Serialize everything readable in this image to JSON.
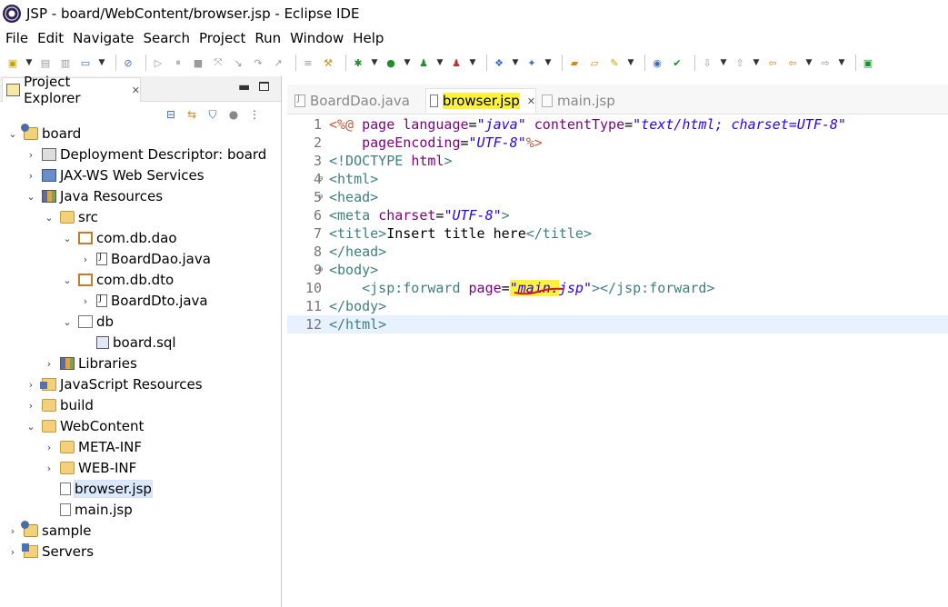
{
  "window": {
    "title": "JSP - board/WebContent/browser.jsp - Eclipse IDE"
  },
  "menu": [
    "File",
    "Edit",
    "Navigate",
    "Search",
    "Project",
    "Run",
    "Window",
    "Help"
  ],
  "explorer": {
    "title": "Project Explorer",
    "tree": [
      {
        "label": "board",
        "level": 0,
        "twisty": "open",
        "icon": "project-icon"
      },
      {
        "label": "Deployment Descriptor: board",
        "level": 1,
        "twisty": "closed",
        "icon": "deployment-descriptor-icon"
      },
      {
        "label": "JAX-WS Web Services",
        "level": 1,
        "twisty": "closed",
        "icon": "web-services-icon"
      },
      {
        "label": "Java Resources",
        "level": 1,
        "twisty": "open",
        "icon": "java-resources-icon"
      },
      {
        "label": "src",
        "level": 2,
        "twisty": "open",
        "icon": "source-folder-icon"
      },
      {
        "label": "com.db.dao",
        "level": 3,
        "twisty": "open",
        "icon": "package-icon"
      },
      {
        "label": "BoardDao.java",
        "level": 4,
        "twisty": "closed",
        "icon": "java-file-icon"
      },
      {
        "label": "com.db.dto",
        "level": 3,
        "twisty": "open",
        "icon": "package-icon"
      },
      {
        "label": "BoardDto.java",
        "level": 4,
        "twisty": "closed",
        "icon": "java-file-icon"
      },
      {
        "label": "db",
        "level": 3,
        "twisty": "open",
        "icon": "empty-package-icon"
      },
      {
        "label": "board.sql",
        "level": 4,
        "twisty": "none",
        "icon": "sql-file-icon"
      },
      {
        "label": "Libraries",
        "level": 2,
        "twisty": "closed",
        "icon": "libraries-icon"
      },
      {
        "label": "JavaScript Resources",
        "level": 1,
        "twisty": "closed",
        "icon": "javascript-resources-icon"
      },
      {
        "label": "build",
        "level": 1,
        "twisty": "closed",
        "icon": "folder-icon"
      },
      {
        "label": "WebContent",
        "level": 1,
        "twisty": "open",
        "icon": "folder-icon"
      },
      {
        "label": "META-INF",
        "level": 2,
        "twisty": "closed",
        "icon": "folder-icon"
      },
      {
        "label": "WEB-INF",
        "level": 2,
        "twisty": "closed",
        "icon": "folder-icon"
      },
      {
        "label": "browser.jsp",
        "level": 2,
        "twisty": "none",
        "icon": "jsp-file-icon",
        "selected": true
      },
      {
        "label": "main.jsp",
        "level": 2,
        "twisty": "none",
        "icon": "jsp-file-icon"
      },
      {
        "label": "sample",
        "level": 0,
        "twisty": "closed",
        "icon": "project-icon"
      },
      {
        "label": "Servers",
        "level": 0,
        "twisty": "closed",
        "icon": "servers-icon"
      }
    ]
  },
  "editor": {
    "tabs": [
      {
        "label": "BoardDao.java",
        "active": false
      },
      {
        "label": "browser.jsp",
        "active": true
      },
      {
        "label": "main.jsp",
        "active": false
      }
    ],
    "lines": [
      {
        "n": "1",
        "fold": "",
        "tokens": [
          [
            "dir",
            "<%@ "
          ],
          [
            "atn",
            "page "
          ],
          [
            "atn",
            "language"
          ],
          [
            "plain",
            "="
          ],
          [
            "atv",
            "\"java\""
          ],
          [
            "plain",
            " "
          ],
          [
            "atn",
            "contentType"
          ],
          [
            "plain",
            "="
          ],
          [
            "atv",
            "\"text/html; charset=UTF-8\""
          ]
        ]
      },
      {
        "n": "2",
        "fold": "",
        "tokens": [
          [
            "plain",
            "    "
          ],
          [
            "atn",
            "pageEncoding"
          ],
          [
            "plain",
            "="
          ],
          [
            "atv",
            "\"UTF-8\""
          ],
          [
            "dir",
            "%>"
          ]
        ]
      },
      {
        "n": "3",
        "fold": "",
        "tokens": [
          [
            "tag",
            "<!DOCTYPE "
          ],
          [
            "atn",
            "html"
          ],
          [
            "tag",
            ">"
          ]
        ]
      },
      {
        "n": "4",
        "fold": "⊖",
        "tokens": [
          [
            "tag",
            "<html>"
          ]
        ]
      },
      {
        "n": "5",
        "fold": "⊖",
        "tokens": [
          [
            "tag",
            "<head>"
          ]
        ]
      },
      {
        "n": "6",
        "fold": "",
        "tokens": [
          [
            "tag",
            "<meta "
          ],
          [
            "atn",
            "charset"
          ],
          [
            "plain",
            "="
          ],
          [
            "atv",
            "\"UTF-8\""
          ],
          [
            "tag",
            ">"
          ]
        ]
      },
      {
        "n": "7",
        "fold": "",
        "tokens": [
          [
            "tag",
            "<title>"
          ],
          [
            "plain",
            "Insert title here"
          ],
          [
            "tag",
            "</title>"
          ]
        ]
      },
      {
        "n": "8",
        "fold": "",
        "tokens": [
          [
            "tag",
            "</head>"
          ]
        ]
      },
      {
        "n": "9",
        "fold": "⊖",
        "tokens": [
          [
            "tag",
            "<body>"
          ]
        ]
      },
      {
        "n": "10",
        "fold": "",
        "tokens": [
          [
            "plain",
            "    "
          ],
          [
            "tag",
            "<jsp:forward "
          ],
          [
            "atn",
            "page"
          ],
          [
            "plain",
            "="
          ],
          [
            "atv-hl",
            "\"main."
          ],
          [
            "atv",
            "jsp\""
          ],
          [
            "tag",
            "></jsp:forward>"
          ]
        ]
      },
      {
        "n": "11",
        "fold": "",
        "tokens": [
          [
            "tag",
            "</body>"
          ]
        ]
      },
      {
        "n": "12",
        "fold": "",
        "tokens": [
          [
            "tag",
            "</html>"
          ]
        ],
        "current": true
      }
    ]
  },
  "colors": {
    "highlight": "#fff23a",
    "tag": "#3f7f7f",
    "attribute_name": "#7f007f",
    "attribute_value": "#2a00ff",
    "current_line": "#e8f2fe",
    "annotation_squiggle": "#e01010"
  }
}
